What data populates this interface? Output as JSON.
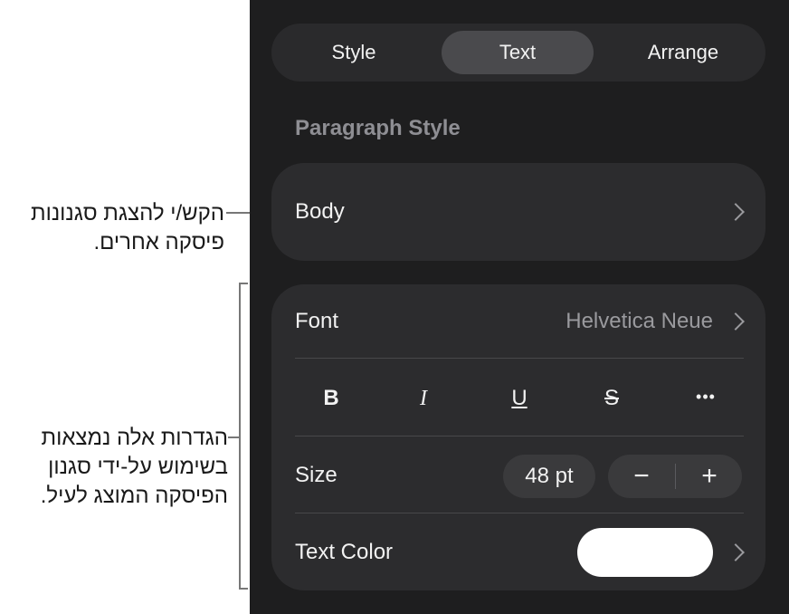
{
  "tabs": {
    "style": "Style",
    "text": "Text",
    "arrange": "Arrange"
  },
  "paragraph_style": {
    "title": "Paragraph Style",
    "value": "Body"
  },
  "font_row": {
    "label": "Font",
    "value": "Helvetica Neue"
  },
  "format_buttons": {
    "bold": "B",
    "italic": "I",
    "underline": "U",
    "strike": "S",
    "more": "•••"
  },
  "size_row": {
    "label": "Size",
    "value": "48 pt",
    "decrement": "−",
    "increment": "+"
  },
  "text_color_row": {
    "label": "Text Color",
    "swatch_color": "#ffffff"
  },
  "callouts": {
    "paragraph_styles": "הקש/י להצגת סגנונות פיסקה אחרים.",
    "settings_note": "הגדרות אלה נמצאות בשימוש על-ידי סגנון הפיסקה המוצג לעיל."
  },
  "colors": {
    "panel_bg": "#1e1e1f",
    "card_bg": "#2c2c2e",
    "selected_tab": "#4a4a4d"
  }
}
